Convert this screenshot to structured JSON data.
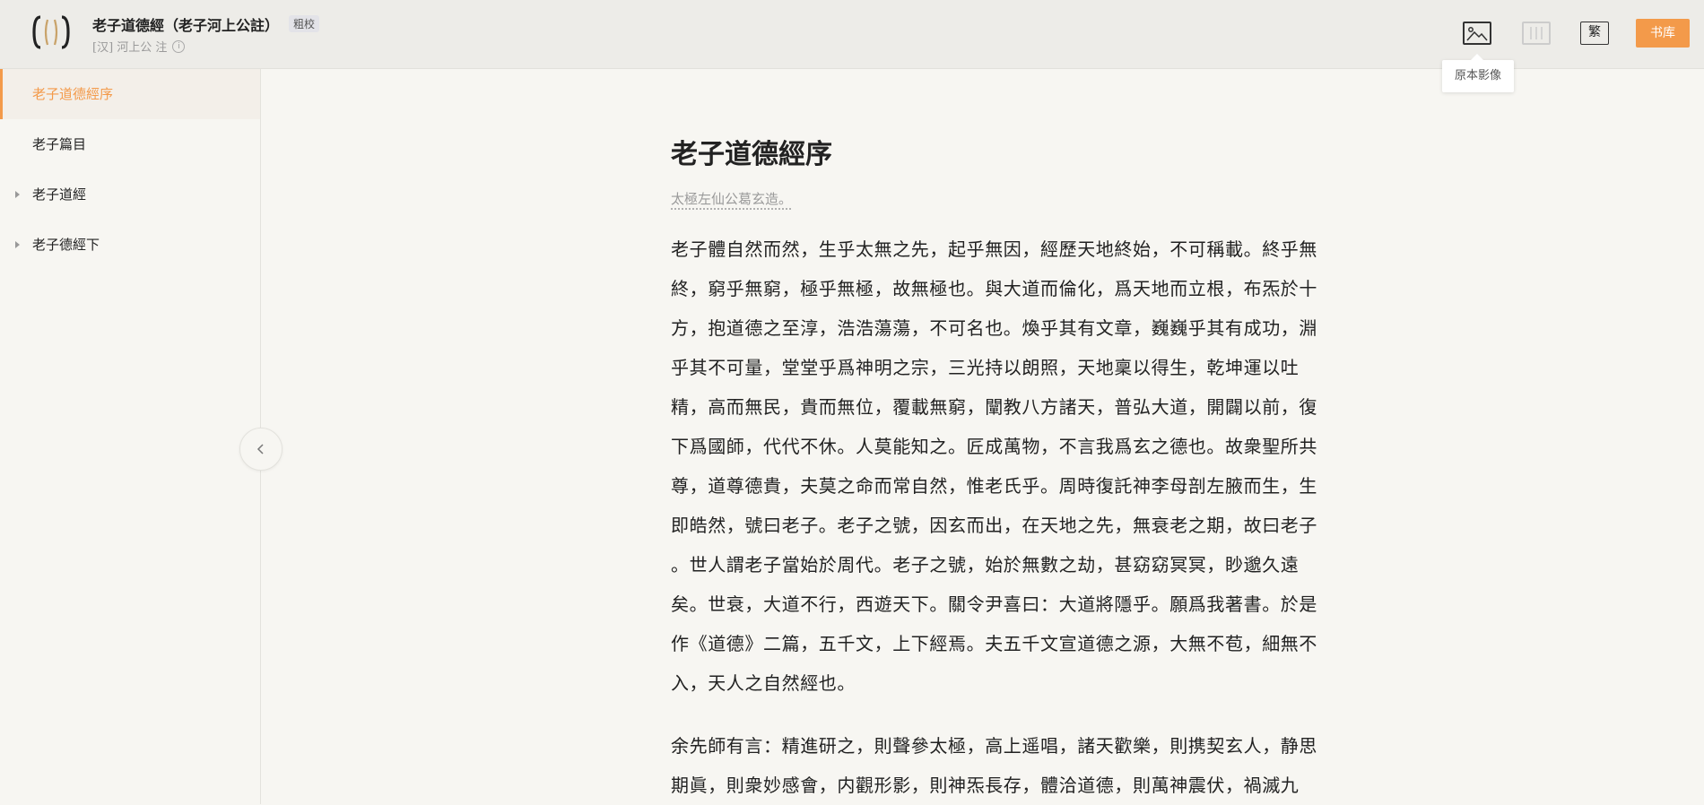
{
  "header": {
    "book_title": "老子道德經（老子河上公註）",
    "edition_badge": "粗校",
    "author_line": "[汉] 河上公 注",
    "info_icon_glyph": "i",
    "trad_toggle": "繁",
    "library_button": "书库",
    "tooltip": "原本影像",
    "accent_color": "#f39a4a"
  },
  "sidebar": {
    "items": [
      {
        "label": "老子道德經序",
        "active": true
      },
      {
        "label": "老子篇目"
      },
      {
        "label": "老子道經",
        "expandable": true
      },
      {
        "label": "老子德經下",
        "expandable": true
      }
    ]
  },
  "main": {
    "title": "老子道德經序",
    "byline": "太極左仙公葛玄造。",
    "paragraphs": [
      [
        "老子體自然而然，生乎太無之先，起乎無因，經歷天地終始，不可稱載。終乎無",
        "終，窮乎無窮，極乎無極，故無極也。與大道而倫化，爲天地而立根，布炁於十",
        "方，抱道德之至淳，浩浩蕩蕩，不可名也。煥乎其有文章，巍巍乎其有成功，淵",
        "乎其不可量，堂堂乎爲神明之宗，三光持以朗照，天地稟以得生，乾坤運以吐",
        "精，高而無民，貴而無位，覆載無窮，闡教八方諸天，普弘大道，開闢以前，復",
        "下爲國師，代代不休。人莫能知之。匠成萬物，不言我爲玄之德也。故衆聖所共",
        "尊，道尊德貴，夫莫之命而常自然，惟老氏乎。周時復託神李母剖左腋而生，生",
        "即皓然，號曰老子。老子之號，因玄而出，在天地之先，無衰老之期，故曰老子",
        "。世人謂老子當始於周代。老子之號，始於無數之劫，甚窈窈冥冥，眇邈久遠",
        "矣。世衰，大道不行，西遊天下。關令尹喜曰：大道將隱乎。願爲我著書。於是",
        "作《道德》二篇，五千文，上下經焉。夫五千文宣道德之源，大無不苞，細無不",
        "入，天人之自然經也。"
      ],
      [
        "余先師有言：精進研之，則聲參太極，高上遥唱，諸天歡樂，則携契玄人，静思",
        "期眞，則衆妙感會，内觀形影，則神炁長存，體洽道德，則萬神震伏，禍滅九"
      ]
    ]
  }
}
